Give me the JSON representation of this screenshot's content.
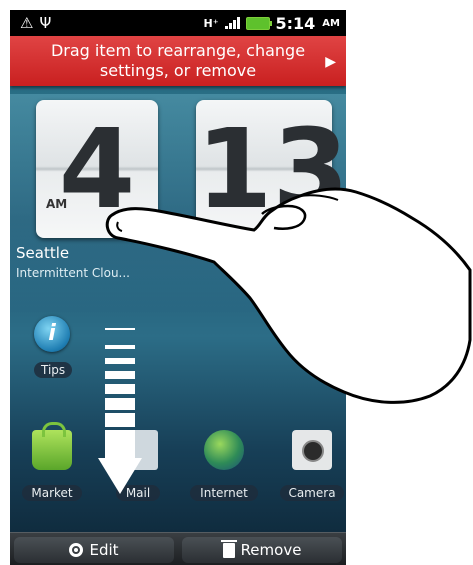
{
  "status_bar": {
    "icons": [
      "alert-icon",
      "usb-icon",
      "hspa-icon",
      "signal-icon",
      "battery-icon"
    ],
    "time": "5:14",
    "ampm": "AM"
  },
  "banner": {
    "text": "Drag item to rearrange, change settings, or remove",
    "color": "#d32f2f"
  },
  "clock": {
    "hour": "4",
    "minute": "13",
    "ampm": "AM"
  },
  "weather": {
    "city": "Seattle",
    "condition": "Intermittent Clou..."
  },
  "shortcuts": {
    "tips": "Tips"
  },
  "dock": {
    "market": "Market",
    "mail": "Mail",
    "internet": "Internet",
    "camera": "Camera"
  },
  "bottom_bar": {
    "edit": "Edit",
    "remove": "Remove"
  }
}
